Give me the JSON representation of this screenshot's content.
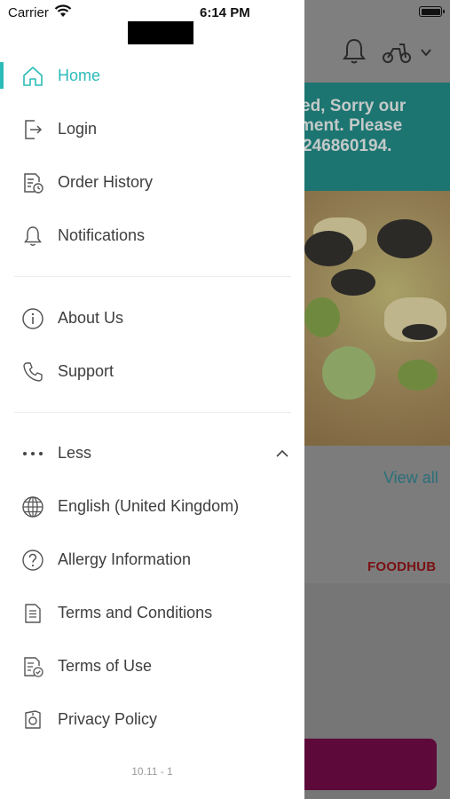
{
  "status_bar": {
    "carrier": "Carrier",
    "time": "6:14 PM"
  },
  "menu": {
    "primary": [
      {
        "label": "Home",
        "icon": "home-icon",
        "active": true
      },
      {
        "label": "Login",
        "icon": "login-icon"
      },
      {
        "label": "Order History",
        "icon": "order-history-icon"
      },
      {
        "label": "Notifications",
        "icon": "bell-icon"
      }
    ],
    "secondary": [
      {
        "label": "About Us",
        "icon": "info-icon"
      },
      {
        "label": "Support",
        "icon": "phone-icon"
      }
    ],
    "less_label": "Less",
    "more_items": [
      {
        "label": "English (United Kingdom)",
        "icon": "globe-icon"
      },
      {
        "label": "Allergy Information",
        "icon": "question-icon"
      },
      {
        "label": "Terms and Conditions",
        "icon": "document-icon"
      },
      {
        "label": "Terms of Use",
        "icon": "document-check-icon"
      },
      {
        "label": "Privacy Policy",
        "icon": "privacy-icon"
      }
    ]
  },
  "version": "10.11 - 1",
  "background": {
    "banner_lines": [
      "ed, Sorry our",
      "ment. Please",
      "246860194."
    ],
    "view_all": "View all",
    "brand": "FOODHUB"
  },
  "colors": {
    "accent": "#2bbbb8",
    "text": "#3e3e3e",
    "banner": "#1c7571",
    "cta": "#5d0a3b"
  }
}
